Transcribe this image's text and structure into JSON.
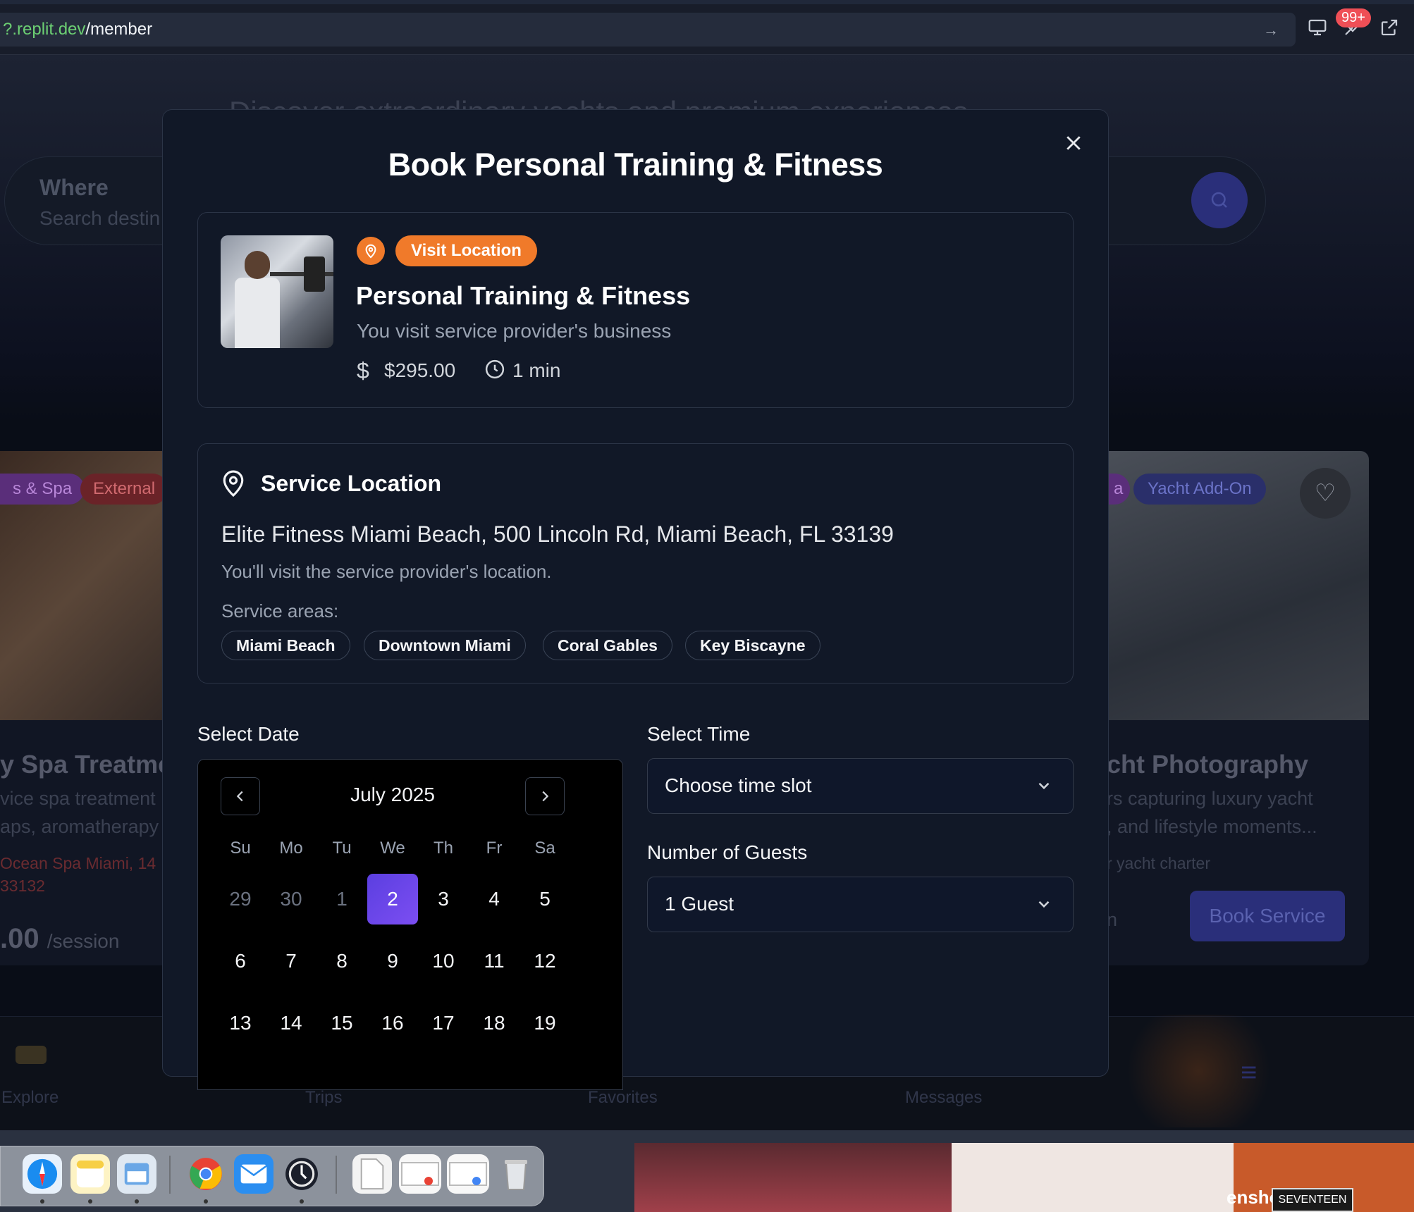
{
  "browser": {
    "url_domain": "?.replit.dev",
    "url_path": "/member",
    "go_icon": "arrow-right-icon",
    "notification_count": "99+"
  },
  "background": {
    "hero_text": "Discover extraordinary yachts and premium experiences",
    "search_where_label": "Where",
    "search_where_placeholder": "Search destin",
    "left_card": {
      "chip1": "s & Spa",
      "chip2": "External",
      "title": "y Spa Treatme",
      "desc1": "vice spa treatment",
      "desc2": "aps, aromatherapy",
      "location1": "Ocean Spa Miami, 14",
      "location2": "33132",
      "price": ".00",
      "price_unit": "/session"
    },
    "right_card": {
      "chip_partial": "a",
      "chip_addon": "Yacht Add-On",
      "title": "cht Photography",
      "desc1": "rs capturing luxury yacht",
      "desc2": ", and lifestyle moments...",
      "location": "r yacht charter",
      "duration_partial": "n",
      "book_button": "Book Service"
    },
    "bottom_nav": [
      "Explore",
      "Trips",
      "Favorites",
      "Messages"
    ]
  },
  "modal": {
    "title": "Book Personal Training & Fitness",
    "close_icon": "close-icon",
    "service": {
      "badge": "Visit Location",
      "name": "Personal Training & Fitness",
      "subtitle": "You visit service provider's business",
      "price": "$295.00",
      "duration": "1 min"
    },
    "location": {
      "title": "Service Location",
      "address": "Elite Fitness Miami Beach, 500 Lincoln Rd, Miami Beach, FL 33139",
      "note": "You'll visit the service provider's location.",
      "areas_label": "Service areas:",
      "areas": [
        "Miami Beach",
        "Downtown Miami",
        "Coral Gables",
        "Key Biscayne"
      ]
    },
    "date": {
      "label": "Select Date",
      "month": "July 2025",
      "weekdays": [
        "Su",
        "Mo",
        "Tu",
        "We",
        "Th",
        "Fr",
        "Sa"
      ],
      "selected_day": "2",
      "rows": [
        [
          "29",
          "30",
          "1",
          "2",
          "3",
          "4",
          "5"
        ],
        [
          "6",
          "7",
          "8",
          "9",
          "10",
          "11",
          "12"
        ],
        [
          "13",
          "14",
          "15",
          "16",
          "17",
          "18",
          "19"
        ]
      ]
    },
    "time": {
      "label": "Select Time",
      "value": "Choose time slot"
    },
    "guests": {
      "label": "Number of Guests",
      "value": "1 Guest"
    }
  },
  "dock": {
    "apps": [
      "safari-icon",
      "notes-icon",
      "preview-icon",
      "chrome-icon",
      "mail-icon",
      "activity-icon",
      "text-file-icon",
      "screenshot-icon",
      "screenshot-icon",
      "trash-icon"
    ],
    "desktop_text": "enshot",
    "desktop_book": "SEVENTEEN"
  }
}
